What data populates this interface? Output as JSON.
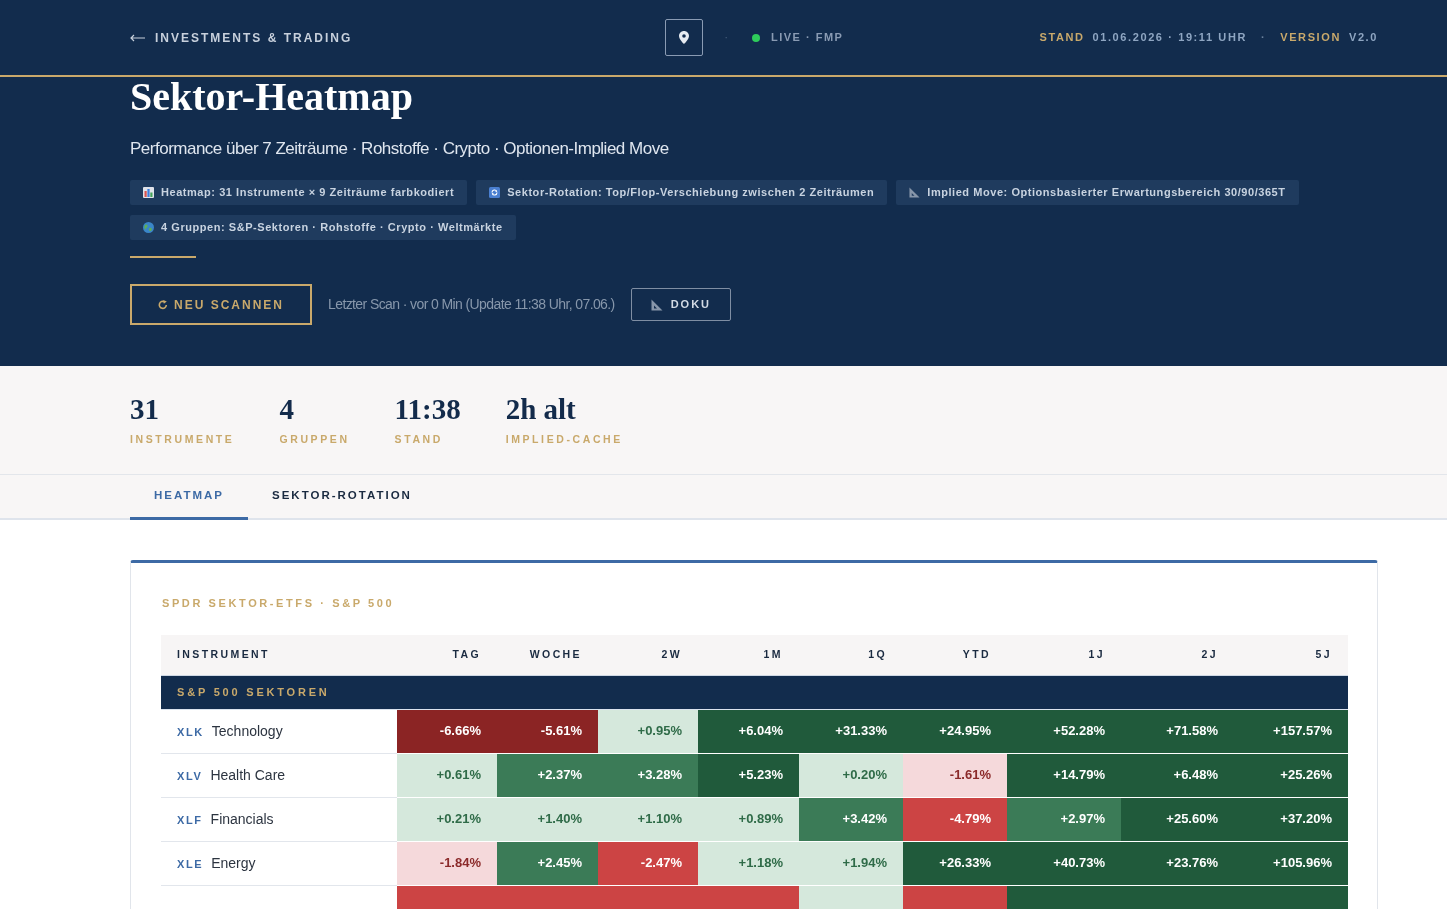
{
  "header": {
    "back_label": "INVESTMENTS & TRADING",
    "separator": "·",
    "status": {
      "live": true,
      "label": "LIVE · FMP"
    },
    "stand": {
      "label": "STAND",
      "value": "01.06.2026 · 19:11 UHR"
    },
    "meta_separator": "·",
    "version": {
      "label": "VERSION",
      "value": "V2.0"
    }
  },
  "hero": {
    "title": "Sektor-Heatmap",
    "subtitle": "Performance über 7 Zeiträume · Rohstoffe · Crypto · Optionen-Implied Move",
    "chips": [
      {
        "kind": "chart",
        "text": "Heatmap: 31 Instrumente × 9 Zeiträume farbkodiert"
      },
      {
        "kind": "rotation",
        "text": "Sektor-Rotation: Top/Flop-Verschiebung zwischen 2 Zeiträumen"
      },
      {
        "kind": "ruler",
        "text": "Implied Move: Optionsbasierter Erwartungsbereich 30/90/365T"
      },
      {
        "kind": "globe",
        "text": "4 Gruppen: S&P-Sektoren · Rohstoffe · Crypto · Weltmärkte"
      }
    ],
    "scan_button": "NEU SCANNEN",
    "last_scan": "Letzter Scan · vor 0 Min (Update 11:38 Uhr, 07.06.)",
    "doc_button": "DOKU"
  },
  "stats": [
    {
      "value": "31",
      "label": "INSTRUMENTE"
    },
    {
      "value": "4",
      "label": "GRUPPEN"
    },
    {
      "value": "11:38",
      "label": "STAND"
    },
    {
      "value": "2h alt",
      "label": "IMPLIED-CACHE"
    }
  ],
  "tabs": [
    {
      "label": "HEATMAP",
      "selected": true
    },
    {
      "label": "SEKTOR-ROTATION",
      "selected": false
    }
  ],
  "heatmap": {
    "title": "SPDR SEKTOR-ETFS · S&P 500",
    "columns": [
      "INSTRUMENT",
      "TAG",
      "WOCHE",
      "2W",
      "1M",
      "1Q",
      "YTD",
      "1J",
      "2J",
      "5J"
    ],
    "groups": [
      {
        "name": "S&P 500 SEKTOREN",
        "rows": [
          {
            "ticker": "XLK",
            "name": "Technology",
            "cells": [
              {
                "value": "-6.66%",
                "color": "#8b2424"
              },
              {
                "value": "-5.61%",
                "color": "#8b2424"
              },
              {
                "value": "+0.95%",
                "color": "#d5e8dc"
              },
              {
                "value": "+6.04%",
                "color": "#205a3b"
              },
              {
                "value": "+31.33%",
                "color": "#205a3b"
              },
              {
                "value": "+24.95%",
                "color": "#205a3b"
              },
              {
                "value": "+52.28%",
                "color": "#205a3b"
              },
              {
                "value": "+71.58%",
                "color": "#205a3b"
              },
              {
                "value": "+157.57%",
                "color": "#205a3b"
              }
            ]
          },
          {
            "ticker": "XLV",
            "name": "Health Care",
            "cells": [
              {
                "value": "+0.61%",
                "color": "#d5e8dc"
              },
              {
                "value": "+2.37%",
                "color": "#3b7b57"
              },
              {
                "value": "+3.28%",
                "color": "#3b7b57"
              },
              {
                "value": "+5.23%",
                "color": "#205a3b"
              },
              {
                "value": "+0.20%",
                "color": "#d5e8dc"
              },
              {
                "value": "-1.61%",
                "color": "#f5d9db"
              },
              {
                "value": "+14.79%",
                "color": "#205a3b"
              },
              {
                "value": "+6.48%",
                "color": "#205a3b"
              },
              {
                "value": "+25.26%",
                "color": "#205a3b"
              }
            ]
          },
          {
            "ticker": "XLF",
            "name": "Financials",
            "cells": [
              {
                "value": "+0.21%",
                "color": "#d5e8dc"
              },
              {
                "value": "+1.40%",
                "color": "#d5e8dc"
              },
              {
                "value": "+1.10%",
                "color": "#d5e8dc"
              },
              {
                "value": "+0.89%",
                "color": "#d5e8dc"
              },
              {
                "value": "+3.42%",
                "color": "#3b7b57"
              },
              {
                "value": "-4.79%",
                "color": "#cc4444"
              },
              {
                "value": "+2.97%",
                "color": "#3b7b57"
              },
              {
                "value": "+25.60%",
                "color": "#205a3b"
              },
              {
                "value": "+37.20%",
                "color": "#205a3b"
              }
            ]
          },
          {
            "ticker": "XLE",
            "name": "Energy",
            "cells": [
              {
                "value": "-1.84%",
                "color": "#f5d9db"
              },
              {
                "value": "+2.45%",
                "color": "#3b7b57"
              },
              {
                "value": "-2.47%",
                "color": "#cc4444"
              },
              {
                "value": "+1.18%",
                "color": "#d5e8dc"
              },
              {
                "value": "+1.94%",
                "color": "#d5e8dc"
              },
              {
                "value": "+26.33%",
                "color": "#205a3b"
              },
              {
                "value": "+40.73%",
                "color": "#205a3b"
              },
              {
                "value": "+23.76%",
                "color": "#205a3b"
              },
              {
                "value": "+105.96%",
                "color": "#205a3b"
              }
            ]
          },
          {
            "cells": [
              {
                "color": "#cc4444"
              },
              {
                "color": "#cc4444"
              },
              {
                "color": "#cc4444"
              },
              {
                "color": "#cc4444"
              },
              {
                "color": "#d5e8dc"
              },
              {
                "color": "#cc4444"
              },
              {
                "color": "#205a3b"
              },
              {
                "color": "#205a3b"
              },
              {
                "color": "#205a3b"
              }
            ]
          }
        ]
      }
    ]
  }
}
